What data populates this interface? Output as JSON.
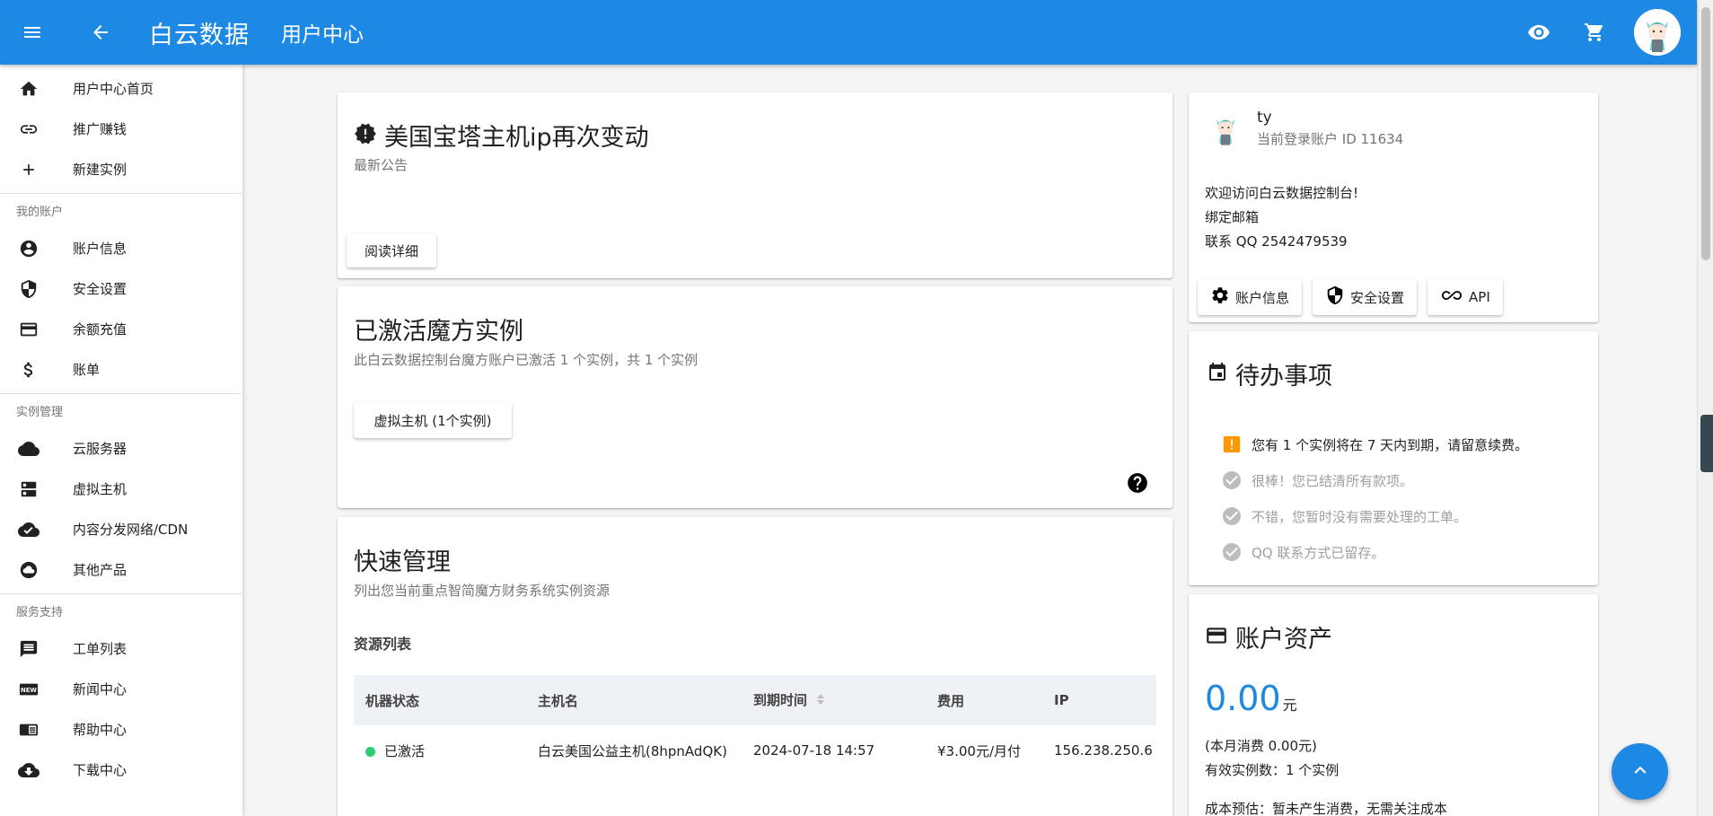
{
  "topbar": {
    "brand": "白云数据",
    "subtitle": "用户中心",
    "icons": [
      "menu-icon",
      "arrow-back-icon",
      "eye-icon",
      "cart-icon",
      "avatar"
    ]
  },
  "sidebar": {
    "top_items": [
      {
        "label": "用户中心首页",
        "icon": "home-icon"
      },
      {
        "label": "推广赚钱",
        "icon": "link-icon"
      },
      {
        "label": "新建实例",
        "icon": "plus-icon"
      }
    ],
    "sections": [
      {
        "heading": "我的账户",
        "items": [
          {
            "label": "账户信息",
            "icon": "account-circle-icon"
          },
          {
            "label": "安全设置",
            "icon": "shield-icon"
          },
          {
            "label": "余额充值",
            "icon": "credit-card-icon"
          },
          {
            "label": "账单",
            "icon": "dollar-icon"
          }
        ]
      },
      {
        "heading": "实例管理",
        "items": [
          {
            "label": "云服务器",
            "icon": "cloud-icon"
          },
          {
            "label": "虚拟主机",
            "icon": "server-icon"
          },
          {
            "label": "内容分发网络/CDN",
            "icon": "cloud-done-icon"
          },
          {
            "label": "其他产品",
            "icon": "cloud-circle-icon"
          }
        ]
      },
      {
        "heading": "服务支持",
        "items": [
          {
            "label": "工单列表",
            "icon": "message-icon"
          },
          {
            "label": "新闻中心",
            "icon": "new-badge-icon"
          },
          {
            "label": "帮助中心",
            "icon": "book-icon"
          },
          {
            "label": "下载中心",
            "icon": "cloud-download-icon"
          }
        ]
      }
    ]
  },
  "announcement": {
    "title": "美国宝塔主机ip再次变动",
    "subtitle": "最新公告",
    "button": "阅读详细"
  },
  "instances": {
    "title": "已激活魔方实例",
    "subtitle": "此白云数据控制台魔方账户已激活 1 个实例，共 1 个实例",
    "button": "虚拟主机 (1个实例)"
  },
  "quick": {
    "title": "快速管理",
    "subtitle": "列出您当前重点智简魔方财务系统实例资源",
    "resource_title": "资源列表",
    "columns": [
      "机器状态",
      "主机名",
      "到期时间",
      "费用",
      "IP"
    ],
    "rows": [
      {
        "status": "已激活",
        "hostname": "白云美国公益主机(8hpnAdQK)",
        "expire": "2024-07-18 14:57",
        "fee": "¥3.00元/月付",
        "ip": "156.238.250.6"
      }
    ]
  },
  "profile": {
    "name": "ty",
    "id_line": "当前登录账户 ID 11634",
    "lines": [
      "欢迎访问白云数据控制台!",
      "绑定邮箱",
      "联系 QQ 2542479539"
    ],
    "buttons": {
      "account": "账户信息",
      "security": "安全设置",
      "api": "API"
    }
  },
  "todo": {
    "title": "待办事项",
    "items": [
      {
        "text": "您有 1 个实例将在 7 天内到期，请留意续费。",
        "state": "warning"
      },
      {
        "text": "很棒！您已结清所有款项。",
        "state": "done"
      },
      {
        "text": "不错，您暂时没有需要处理的工单。",
        "state": "done"
      },
      {
        "text": "QQ 联系方式已留存。",
        "state": "done"
      }
    ]
  },
  "assets": {
    "title": "账户资产",
    "balance": "0.00",
    "unit": "元",
    "monthly": "(本月消费 0.00元)",
    "active_count": "有效实例数：1 个实例",
    "estimate": "成本预估：暂未产生消费，无需关注成本"
  },
  "colors": {
    "primary": "#1e88e5",
    "status_active": "#2ecc71",
    "warning": "#ff9800",
    "muted": "#9e9e9e"
  }
}
